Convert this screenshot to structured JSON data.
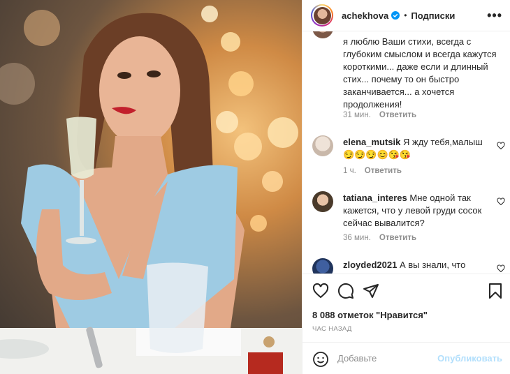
{
  "post": {
    "username": "achekhova",
    "separator": "•",
    "follow_label": "Подписки",
    "more_label": "•••"
  },
  "comments": [
    {
      "text": "я люблю Ваши стихи, всегда с глубоким смыслом и всегда кажутся короткими... даже если и длинный стих... почему то он быстро заканчивается... а хочется продолжения!",
      "time": "31 мин.",
      "reply": "Ответить"
    },
    {
      "user": "elena_mutsik",
      "text": "Я жду тебя,малыш",
      "emoji": "😏😏😏😊😘😘",
      "time": "1 ч.",
      "reply": "Ответить"
    },
    {
      "user": "tatiana_interes",
      "text": "Мне одной так кажется, что у левой груди сосок сейчас вывалится?",
      "time": "36 мин.",
      "reply": "Ответить"
    },
    {
      "user": "zloyded2021",
      "text": "А вы знали, что"
    }
  ],
  "likes_text": "8 088 отметок \"Нравится\"",
  "timestamp": "ЧАС НАЗАД",
  "composer": {
    "placeholder": "Добавьте",
    "publish_label": "Опубликовать"
  },
  "colors": {
    "accent": "#0095f6",
    "publish_disabled": "#b2dffc",
    "muted_text": "#8e8e8e",
    "border": "#efefef"
  }
}
